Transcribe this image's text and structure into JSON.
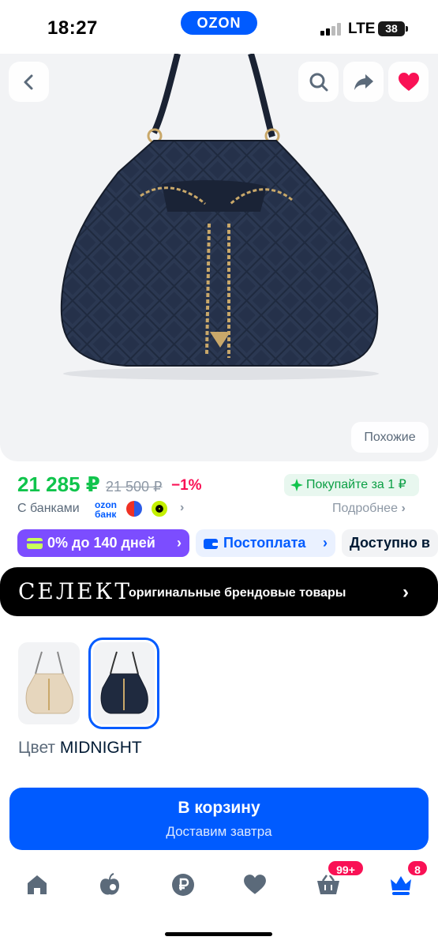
{
  "status_bar": {
    "time": "18:27",
    "brand": "OZON",
    "network": "LTE",
    "battery": "38"
  },
  "gallery": {
    "back_icon": "chevron-left-icon",
    "search_icon": "search-icon",
    "share_icon": "share-icon",
    "favorite_icon": "heart-icon",
    "similar_label": "Похожие"
  },
  "price": {
    "current": "21 285 ₽",
    "old": "21 500 ₽",
    "discount": "−1%",
    "buy_for": "Покупайте за 1 ₽",
    "with_banks": "С банками",
    "ozon_bank": "ozon банк",
    "more": "Подробнее"
  },
  "chips": {
    "credit": "0% до 140 дней",
    "postpay": "Постоплата",
    "available": "Доступно в"
  },
  "select_banner": {
    "logo": "СЕЛЕКТ",
    "text": "оригинальные брендовые товары"
  },
  "variants": {
    "color_label": "Цвет",
    "color_value": "MIDNIGHT",
    "items": [
      {
        "name": "beige",
        "selected": false
      },
      {
        "name": "midnight",
        "selected": true
      }
    ]
  },
  "cart": {
    "title": "В корзину",
    "subtitle": "Доставим завтра"
  },
  "tabbar": {
    "items": [
      "home-icon",
      "apple-icon",
      "ruble-icon",
      "heart-icon",
      "basket-icon",
      "crown-icon"
    ],
    "cart_badge": "99+",
    "profile_badge": "8"
  },
  "colors": {
    "brand": "#005bff",
    "price_green": "#10c44c",
    "discount_red": "#f91155",
    "credit_purple": "#7c4dff"
  }
}
